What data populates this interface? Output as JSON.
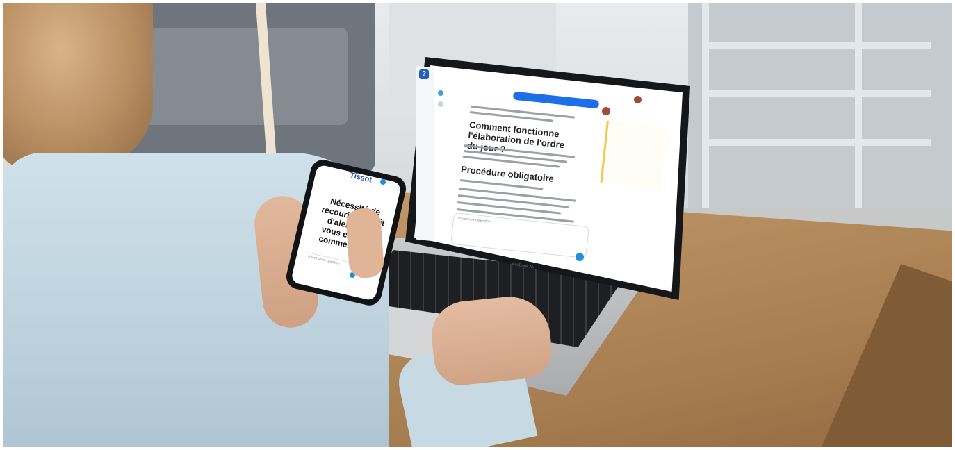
{
  "photo": {
    "phone": {
      "logo": "Tissot",
      "headline": "Nécessité de recourir au droit d'alerte ? Je vous explique comment faire",
      "input_placeholder": "Posez votre question"
    },
    "laptop": {
      "heading_1": "Comment fonctionne l'élaboration de l'ordre du jour ?",
      "heading_2": "Procédure obligatoire",
      "prompt_input_placeholder": "Posez votre question",
      "keyboard_brand": "MacBook Air"
    },
    "colors": {
      "chat_accent": "#1c6fe8",
      "send_button": "#1c8fe0",
      "logo_blue": "#1f5fc2",
      "panel_highlight": "#f2c94c"
    },
    "icons": [
      "send-icon",
      "app-logo-icon",
      "user-avatar-icon"
    ]
  }
}
